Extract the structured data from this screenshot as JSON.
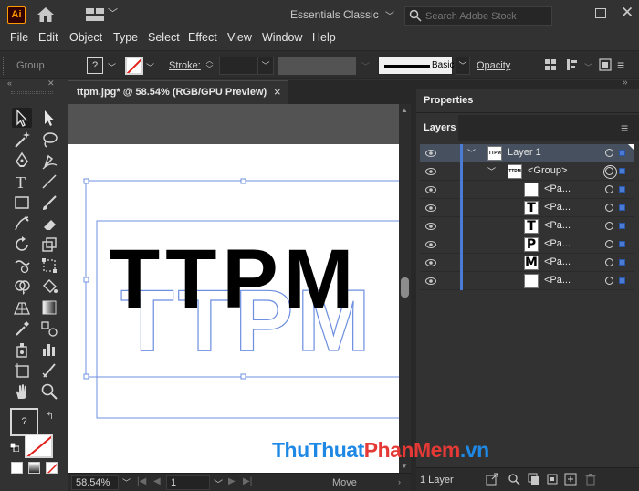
{
  "app": {
    "logo": "Ai",
    "workspace": "Essentials Classic",
    "search_placeholder": "Search Adobe Stock"
  },
  "menu": [
    "File",
    "Edit",
    "Object",
    "Type",
    "Select",
    "Effect",
    "View",
    "Window",
    "Help"
  ],
  "control_bar": {
    "selection_type": "Group",
    "fill_swatch": "?",
    "stroke_label": "Stroke:",
    "brush_label": "Basic",
    "opacity_label": "Opacity"
  },
  "toolbar": {
    "fill_swatch": "?"
  },
  "document": {
    "tab_title": "ttpm.jpg* @ 58.54% (RGB/GPU Preview)",
    "close": "×",
    "artwork_text": "TTPM",
    "outline_text": "TTPM"
  },
  "status_bar": {
    "zoom": "58.54%",
    "page": "1",
    "tool": "Move"
  },
  "panels": {
    "properties_tab": "Properties",
    "layers_tab": "Layers",
    "layers": [
      {
        "name": "Layer 1",
        "thumb": "TTPM",
        "level": 0,
        "expanded": true,
        "selected": true
      },
      {
        "name": "<Group>",
        "thumb": "TTPM",
        "level": 1,
        "expanded": true,
        "selected": false
      },
      {
        "name": "<Pa...",
        "thumb": "",
        "level": 2,
        "expanded": false,
        "selected": false
      },
      {
        "name": "<Pa...",
        "thumb": "T",
        "level": 2,
        "expanded": false,
        "selected": false
      },
      {
        "name": "<Pa...",
        "thumb": "T",
        "level": 2,
        "expanded": false,
        "selected": false
      },
      {
        "name": "<Pa...",
        "thumb": "P",
        "level": 2,
        "expanded": false,
        "selected": false
      },
      {
        "name": "<Pa...",
        "thumb": "M",
        "level": 2,
        "expanded": false,
        "selected": false
      },
      {
        "name": "<Pa...",
        "thumb": "",
        "level": 2,
        "expanded": false,
        "selected": false
      }
    ],
    "layer_count": "1 Layer"
  },
  "watermark": {
    "part1": "ThuThuat",
    "part2": "PhanMem",
    "part3": ".vn"
  },
  "colors": {
    "accent": "#4b7bd4",
    "app_bg": "#323232",
    "logo_orange": "#ff9a00",
    "none_red": "#e0201b"
  }
}
